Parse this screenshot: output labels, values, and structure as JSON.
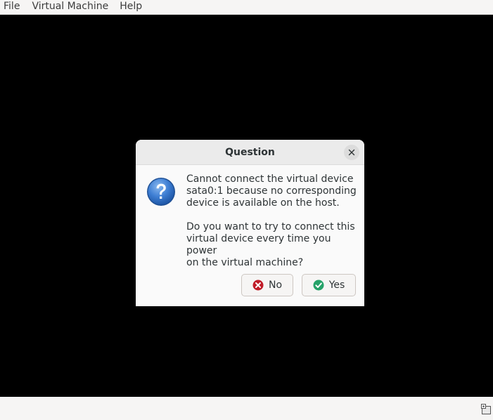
{
  "menubar": {
    "items": [
      {
        "label": "File"
      },
      {
        "label": "Virtual Machine"
      },
      {
        "label": "Help"
      }
    ]
  },
  "dialog": {
    "title": "Question",
    "message_line1": "Cannot connect the virtual device\nsata0:1 because no corresponding\ndevice is available on the host.",
    "message_line2": "Do you want to try to connect this\nvirtual device every time you power\non the virtual machine?",
    "no_label": "No",
    "yes_label": "Yes",
    "icons": {
      "question": "question-icon",
      "close": "close-icon",
      "no": "no-icon",
      "yes": "yes-icon"
    }
  },
  "colors": {
    "console_bg": "#000000",
    "chrome_bg": "#f6f5f4",
    "no_red": "#c01c28",
    "yes_green": "#26a269",
    "question_blue": "#3a7bd5"
  }
}
